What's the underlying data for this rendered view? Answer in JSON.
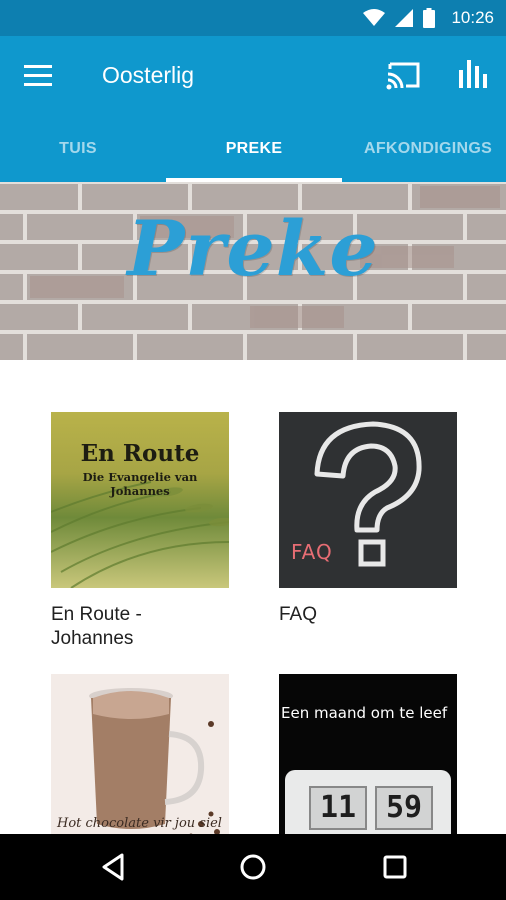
{
  "status_bar": {
    "time": "10:26",
    "icons": [
      "wifi-icon",
      "cell-signal-icon",
      "battery-icon"
    ]
  },
  "app_bar": {
    "title": "Oosterlig",
    "icons": [
      "menu-icon",
      "cast-icon",
      "bar-chart-icon"
    ]
  },
  "tabs": [
    {
      "label": "TUIS",
      "active": false
    },
    {
      "label": "PREKE",
      "active": true
    },
    {
      "label": "AFKONDIGINGS",
      "active": false
    }
  ],
  "banner": {
    "title": "Preke"
  },
  "cards": [
    {
      "label": "En Route - Johannes",
      "thumb_title": "En Route",
      "thumb_subtitle": "Die Evangelie van Johannes"
    },
    {
      "label": "FAQ",
      "thumb_text": "FAQ"
    },
    {
      "label": "",
      "thumb_text": "Hot chocolate vir jou siel"
    },
    {
      "label": "",
      "thumb_text": "Een maand om te leef",
      "clock_hours": "11",
      "clock_minutes": "59"
    }
  ],
  "colors": {
    "status_bar": "#0d7fb0",
    "app_bar": "#0f98cd",
    "banner_title": "#2c9fd6",
    "text_primary": "#212121"
  },
  "nav_bar": {
    "icons": [
      "back-icon",
      "home-icon",
      "recents-icon"
    ]
  }
}
